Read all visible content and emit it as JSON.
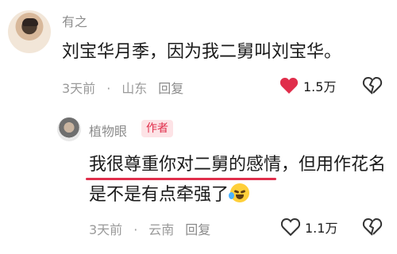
{
  "comment": {
    "username": "有之",
    "text": "刘宝华月季，因为我二舅叫刘宝华。",
    "time": "3天前",
    "location": "山东",
    "reply_label": "回复",
    "like_count": "1.5万",
    "liked": true
  },
  "reply": {
    "username": "植物眼",
    "author_badge": "作者",
    "text_line1": "我很尊重你对二舅的感情，但用作花名",
    "text_line2": "是不是有点牵强了",
    "time": "3天前",
    "location": "云南",
    "reply_label": "回复",
    "like_count": "1.1万",
    "liked": false
  },
  "colors": {
    "accent": "#e02e4b",
    "meta": "#9a9a9a"
  },
  "icons": [
    "heart-icon",
    "broken-heart-icon",
    "crying-laughing-emoji"
  ]
}
